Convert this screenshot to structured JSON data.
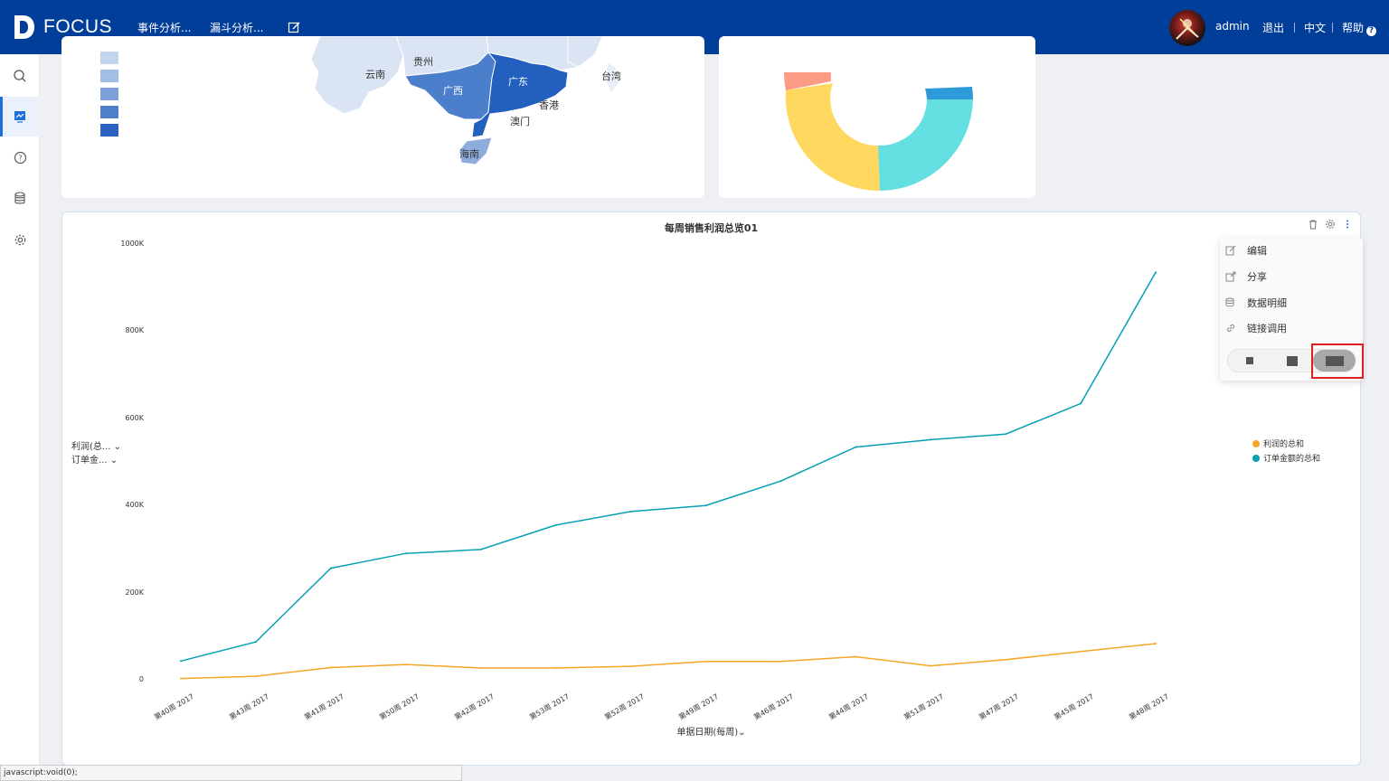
{
  "brand": {
    "name": "FOCUS"
  },
  "nav": {
    "items": [
      "事件分析...",
      "漏斗分析..."
    ],
    "user": "admin",
    "logout": "退出",
    "language": "中文",
    "help": "帮助"
  },
  "sidebar": {
    "items": [
      "search-icon",
      "dashboard-icon",
      "help-circle-icon",
      "database-icon",
      "settings-icon"
    ],
    "active_index": 1
  },
  "map_card": {
    "labels": {
      "yunnan": "云南",
      "guizhou": "贵州",
      "guangxi": "广西",
      "guangdong": "广东",
      "xianggang": "香港",
      "aomen": "澳门",
      "hainan": "海南",
      "taiwan": "台湾"
    },
    "legend_colors": [
      "#c3d4ee",
      "#a3bde4",
      "#7b9fd6",
      "#4f7fcb",
      "#2a62c0"
    ]
  },
  "pie_card": {
    "colors": {
      "coral": "#fb9b83",
      "yellow": "#ffd95f",
      "cyan": "#63dfe2",
      "blue": "#2f9ad9"
    }
  },
  "chart_card": {
    "title": "每周销售利润总览01",
    "y_selectors": [
      "利润(总...",
      "订单金..."
    ],
    "x_axis_label": "单据日期(每周)",
    "legend": [
      "利润的总和",
      "订单金额的总和"
    ],
    "tools": [
      "trash-icon",
      "gear-icon",
      "more-vertical-icon"
    ]
  },
  "chart_data": {
    "type": "line",
    "title": "每周销售利润总览01",
    "xlabel": "单据日期(每周)",
    "ylabel": "",
    "y_tick_labels": [
      "0",
      "200K",
      "400K",
      "600K",
      "800K",
      "1000K"
    ],
    "ylim": [
      0,
      1000000
    ],
    "categories": [
      "第40周 2017",
      "第43周 2017",
      "第41周 2017",
      "第50周 2017",
      "第42周 2017",
      "第53周 2017",
      "第52周 2017",
      "第49周 2017",
      "第46周 2017",
      "第44周 2017",
      "第51周 2017",
      "第47周 2017",
      "第45周 2017",
      "第48周 2017"
    ],
    "series": [
      {
        "name": "利润的总和",
        "color": "#f5a623",
        "values": [
          3000,
          8000,
          28000,
          35000,
          27000,
          27000,
          31000,
          42000,
          42000,
          53000,
          32000,
          46000,
          65000,
          83000
        ]
      },
      {
        "name": "订单金额的总和",
        "color": "#06a0b4",
        "values": [
          43000,
          87000,
          256000,
          290000,
          299000,
          355000,
          386000,
          400000,
          456000,
          534000,
          551000,
          564000,
          634000,
          935000
        ]
      }
    ],
    "grid": false,
    "legend_position": "right"
  },
  "popup_menu": {
    "items": [
      {
        "label": "编辑",
        "icon": "edit-icon"
      },
      {
        "label": "分享",
        "icon": "share-icon"
      },
      {
        "label": "数据明细",
        "icon": "data-detail-icon"
      },
      {
        "label": "链接调用",
        "icon": "link-icon"
      }
    ],
    "size_options": [
      "small-size-icon",
      "medium-size-icon",
      "large-size-icon"
    ],
    "selected_size": 2
  },
  "status_bar": {
    "text": "javascript:void(0);"
  }
}
